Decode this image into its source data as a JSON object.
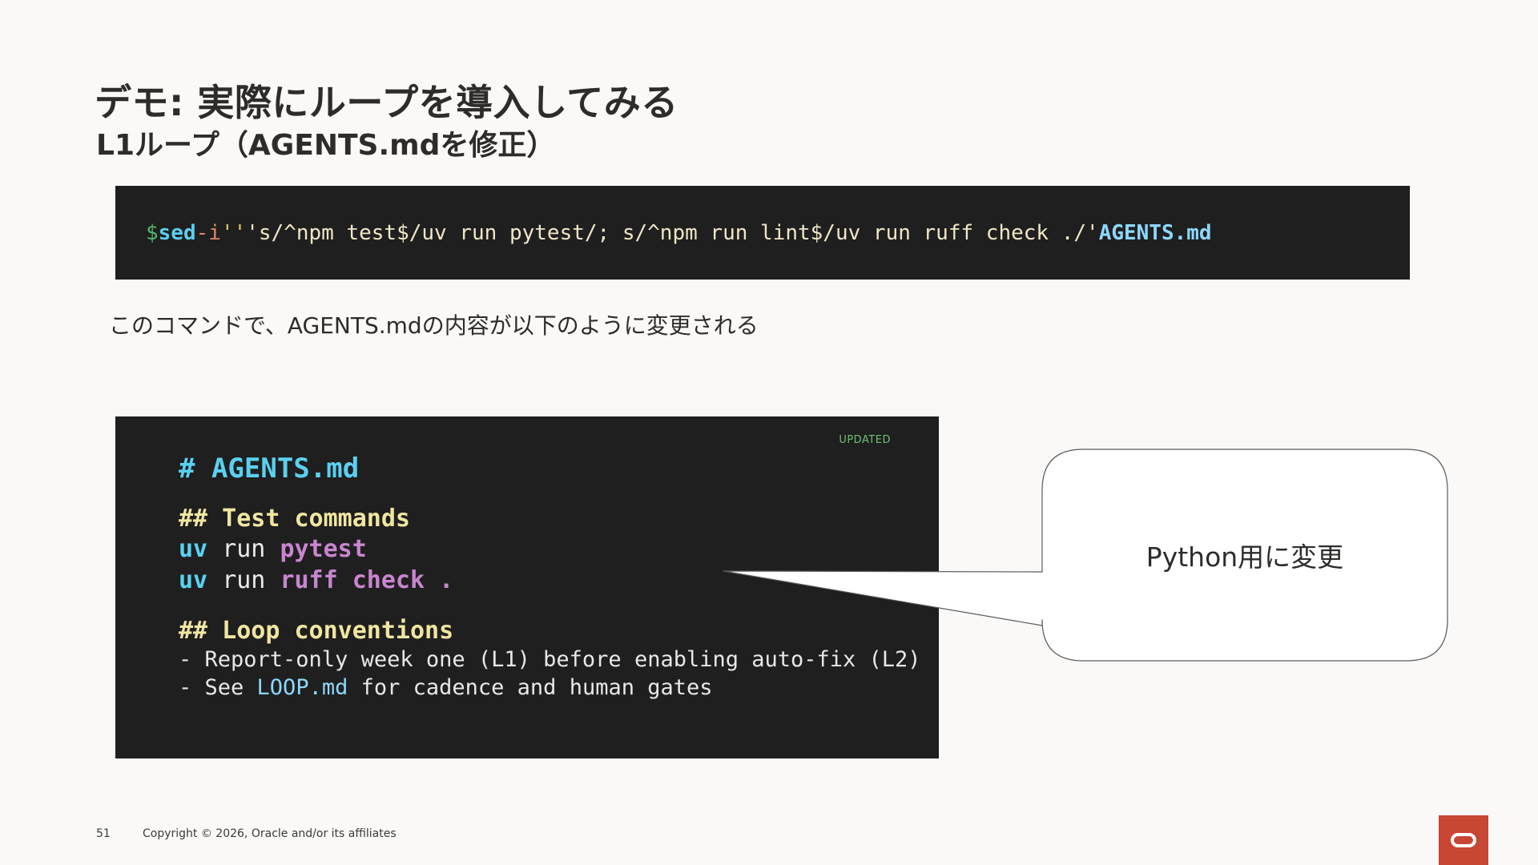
{
  "slide": {
    "title": "デモ: 実際にループを導入してみる",
    "subtitle": "L1ループ（AGENTS.mdを修正）"
  },
  "command": {
    "prompt": "$",
    "program": "sed",
    "flag": "-i",
    "empty_quote": "''",
    "expression": "'s/^npm test$/uv run pytest/; s/^npm run lint$/uv run ruff check ./'",
    "file": "AGENTS.md"
  },
  "description": "このコマンドで、AGENTS.mdの内容が以下のように変更される",
  "code": {
    "badge": "UPDATED",
    "heading": "# AGENTS.md",
    "section1": "## Test commands",
    "cmd1": {
      "tool": "uv",
      "verb": "run",
      "arg": "pytest"
    },
    "cmd2": {
      "tool": "uv",
      "verb": "run",
      "arg": "ruff check ."
    },
    "section2": "## Loop conventions",
    "bullet1": "- Report-only week one (L1) before enabling auto-fix (L2)",
    "bullet2_prefix": "- See",
    "bullet2_link": "LOOP.md",
    "bullet2_suffix": "for cadence and human gates"
  },
  "callout": {
    "text": "Python用に変更"
  },
  "footer": {
    "page": "51",
    "copyright": "Copyright © 2026, Oracle and/or its affiliates"
  },
  "colors": {
    "accent_red": "#c74634",
    "code_background": "#1f1f1f"
  }
}
